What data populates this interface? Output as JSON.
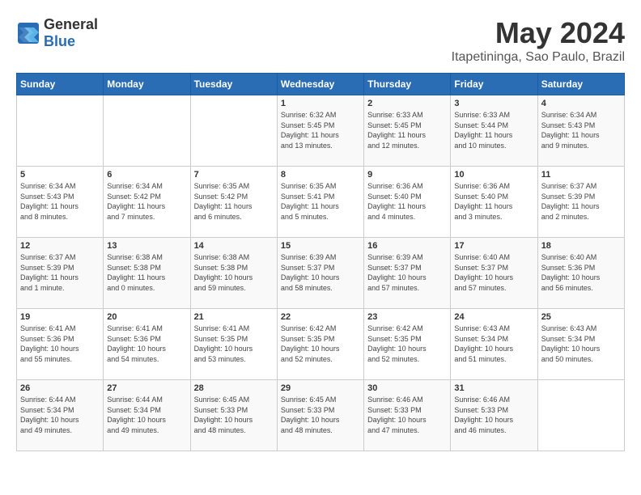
{
  "logo": {
    "general": "General",
    "blue": "Blue"
  },
  "title": "May 2024",
  "subtitle": "Itapetininga, Sao Paulo, Brazil",
  "days_of_week": [
    "Sunday",
    "Monday",
    "Tuesday",
    "Wednesday",
    "Thursday",
    "Friday",
    "Saturday"
  ],
  "weeks": [
    [
      {
        "day": "",
        "info": ""
      },
      {
        "day": "",
        "info": ""
      },
      {
        "day": "",
        "info": ""
      },
      {
        "day": "1",
        "info": "Sunrise: 6:32 AM\nSunset: 5:45 PM\nDaylight: 11 hours\nand 13 minutes."
      },
      {
        "day": "2",
        "info": "Sunrise: 6:33 AM\nSunset: 5:45 PM\nDaylight: 11 hours\nand 12 minutes."
      },
      {
        "day": "3",
        "info": "Sunrise: 6:33 AM\nSunset: 5:44 PM\nDaylight: 11 hours\nand 10 minutes."
      },
      {
        "day": "4",
        "info": "Sunrise: 6:34 AM\nSunset: 5:43 PM\nDaylight: 11 hours\nand 9 minutes."
      }
    ],
    [
      {
        "day": "5",
        "info": "Sunrise: 6:34 AM\nSunset: 5:43 PM\nDaylight: 11 hours\nand 8 minutes."
      },
      {
        "day": "6",
        "info": "Sunrise: 6:34 AM\nSunset: 5:42 PM\nDaylight: 11 hours\nand 7 minutes."
      },
      {
        "day": "7",
        "info": "Sunrise: 6:35 AM\nSunset: 5:42 PM\nDaylight: 11 hours\nand 6 minutes."
      },
      {
        "day": "8",
        "info": "Sunrise: 6:35 AM\nSunset: 5:41 PM\nDaylight: 11 hours\nand 5 minutes."
      },
      {
        "day": "9",
        "info": "Sunrise: 6:36 AM\nSunset: 5:40 PM\nDaylight: 11 hours\nand 4 minutes."
      },
      {
        "day": "10",
        "info": "Sunrise: 6:36 AM\nSunset: 5:40 PM\nDaylight: 11 hours\nand 3 minutes."
      },
      {
        "day": "11",
        "info": "Sunrise: 6:37 AM\nSunset: 5:39 PM\nDaylight: 11 hours\nand 2 minutes."
      }
    ],
    [
      {
        "day": "12",
        "info": "Sunrise: 6:37 AM\nSunset: 5:39 PM\nDaylight: 11 hours\nand 1 minute."
      },
      {
        "day": "13",
        "info": "Sunrise: 6:38 AM\nSunset: 5:38 PM\nDaylight: 11 hours\nand 0 minutes."
      },
      {
        "day": "14",
        "info": "Sunrise: 6:38 AM\nSunset: 5:38 PM\nDaylight: 10 hours\nand 59 minutes."
      },
      {
        "day": "15",
        "info": "Sunrise: 6:39 AM\nSunset: 5:37 PM\nDaylight: 10 hours\nand 58 minutes."
      },
      {
        "day": "16",
        "info": "Sunrise: 6:39 AM\nSunset: 5:37 PM\nDaylight: 10 hours\nand 57 minutes."
      },
      {
        "day": "17",
        "info": "Sunrise: 6:40 AM\nSunset: 5:37 PM\nDaylight: 10 hours\nand 57 minutes."
      },
      {
        "day": "18",
        "info": "Sunrise: 6:40 AM\nSunset: 5:36 PM\nDaylight: 10 hours\nand 56 minutes."
      }
    ],
    [
      {
        "day": "19",
        "info": "Sunrise: 6:41 AM\nSunset: 5:36 PM\nDaylight: 10 hours\nand 55 minutes."
      },
      {
        "day": "20",
        "info": "Sunrise: 6:41 AM\nSunset: 5:36 PM\nDaylight: 10 hours\nand 54 minutes."
      },
      {
        "day": "21",
        "info": "Sunrise: 6:41 AM\nSunset: 5:35 PM\nDaylight: 10 hours\nand 53 minutes."
      },
      {
        "day": "22",
        "info": "Sunrise: 6:42 AM\nSunset: 5:35 PM\nDaylight: 10 hours\nand 52 minutes."
      },
      {
        "day": "23",
        "info": "Sunrise: 6:42 AM\nSunset: 5:35 PM\nDaylight: 10 hours\nand 52 minutes."
      },
      {
        "day": "24",
        "info": "Sunrise: 6:43 AM\nSunset: 5:34 PM\nDaylight: 10 hours\nand 51 minutes."
      },
      {
        "day": "25",
        "info": "Sunrise: 6:43 AM\nSunset: 5:34 PM\nDaylight: 10 hours\nand 50 minutes."
      }
    ],
    [
      {
        "day": "26",
        "info": "Sunrise: 6:44 AM\nSunset: 5:34 PM\nDaylight: 10 hours\nand 49 minutes."
      },
      {
        "day": "27",
        "info": "Sunrise: 6:44 AM\nSunset: 5:34 PM\nDaylight: 10 hours\nand 49 minutes."
      },
      {
        "day": "28",
        "info": "Sunrise: 6:45 AM\nSunset: 5:33 PM\nDaylight: 10 hours\nand 48 minutes."
      },
      {
        "day": "29",
        "info": "Sunrise: 6:45 AM\nSunset: 5:33 PM\nDaylight: 10 hours\nand 48 minutes."
      },
      {
        "day": "30",
        "info": "Sunrise: 6:46 AM\nSunset: 5:33 PM\nDaylight: 10 hours\nand 47 minutes."
      },
      {
        "day": "31",
        "info": "Sunrise: 6:46 AM\nSunset: 5:33 PM\nDaylight: 10 hours\nand 46 minutes."
      },
      {
        "day": "",
        "info": ""
      }
    ]
  ]
}
